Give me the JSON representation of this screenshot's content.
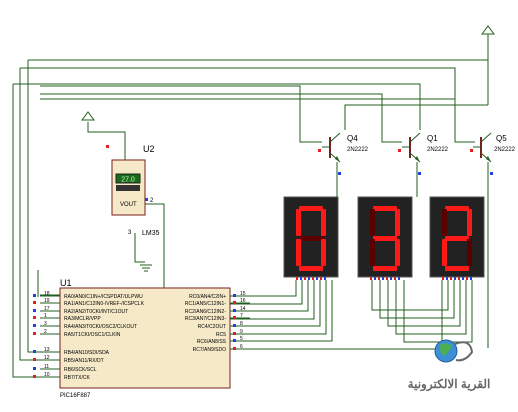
{
  "colors": {
    "wire": "#1f5f1f",
    "body": "#f5e9c8",
    "outline": "#7a1f1f",
    "segment_on": "#ff1a1a",
    "segment_off": "#5a0000",
    "display_bg": "#222222",
    "pin_red": "#e02020",
    "pin_blue": "#2040e0",
    "lcd_bg": "#1a6b1a",
    "lcd_text": "#c8ffc8"
  },
  "u2": {
    "ref": "U2",
    "part": "LM35",
    "reading": "27.0",
    "pin_label": "VOUT",
    "pin_out": "2",
    "pin_gnd": "3"
  },
  "transistors": [
    {
      "ref": "Q4",
      "part": "2N2222"
    },
    {
      "ref": "Q1",
      "part": "2N2222"
    },
    {
      "ref": "Q5",
      "part": "2N2222"
    }
  ],
  "displays": {
    "digits": [
      "0",
      "3",
      "2"
    ],
    "icon": "seven-segment-display"
  },
  "u1": {
    "ref": "U1",
    "part": "PIC16F887",
    "left_pins": [
      {
        "num": "18",
        "label": "RA0/AN0/C1IN+/ICSPDAT/ULPWU"
      },
      {
        "num": "19",
        "label": "RA1/AN1/C12IN0-/VREF-/ICSPCLK"
      },
      {
        "num": "17",
        "label": "RA2/AN2/T0CKI/INT/C1OUT"
      },
      {
        "num": "1",
        "label": "RA3/MCLR/VPP"
      },
      {
        "num": "3",
        "label": "RA4/AN3/T0CKI/OSC2/CLKOUT"
      },
      {
        "num": "2",
        "label": "RA5/T1CKI/OSC1/CLKIN"
      },
      {
        "num": "13",
        "label": "RB4/AN10/SDI/SDA"
      },
      {
        "num": "12",
        "label": "RB5/AN11/RX/DT"
      },
      {
        "num": "11",
        "label": "RB6/SCK/SCL"
      },
      {
        "num": "10",
        "label": "RB7/TX/CK"
      }
    ],
    "right_pins": [
      {
        "num": "15",
        "label": "RC0/AN4/C2IN+"
      },
      {
        "num": "16",
        "label": "RC1/AN5/C12IN1-"
      },
      {
        "num": "14",
        "label": "RC2/AN6/C12IN2-"
      },
      {
        "num": "7",
        "label": "RC3/AN7/C12IN3-"
      },
      {
        "num": "8",
        "label": "RC4/C2OUT"
      },
      {
        "num": "9",
        "label": "RC5"
      },
      {
        "num": "5",
        "label": "RC6/AN8/SS"
      },
      {
        "num": "6",
        "label": "RC7/AN9/SDO"
      }
    ]
  },
  "logo": {
    "text": "القرية الالكترونية",
    "icon": "globe-icon"
  }
}
